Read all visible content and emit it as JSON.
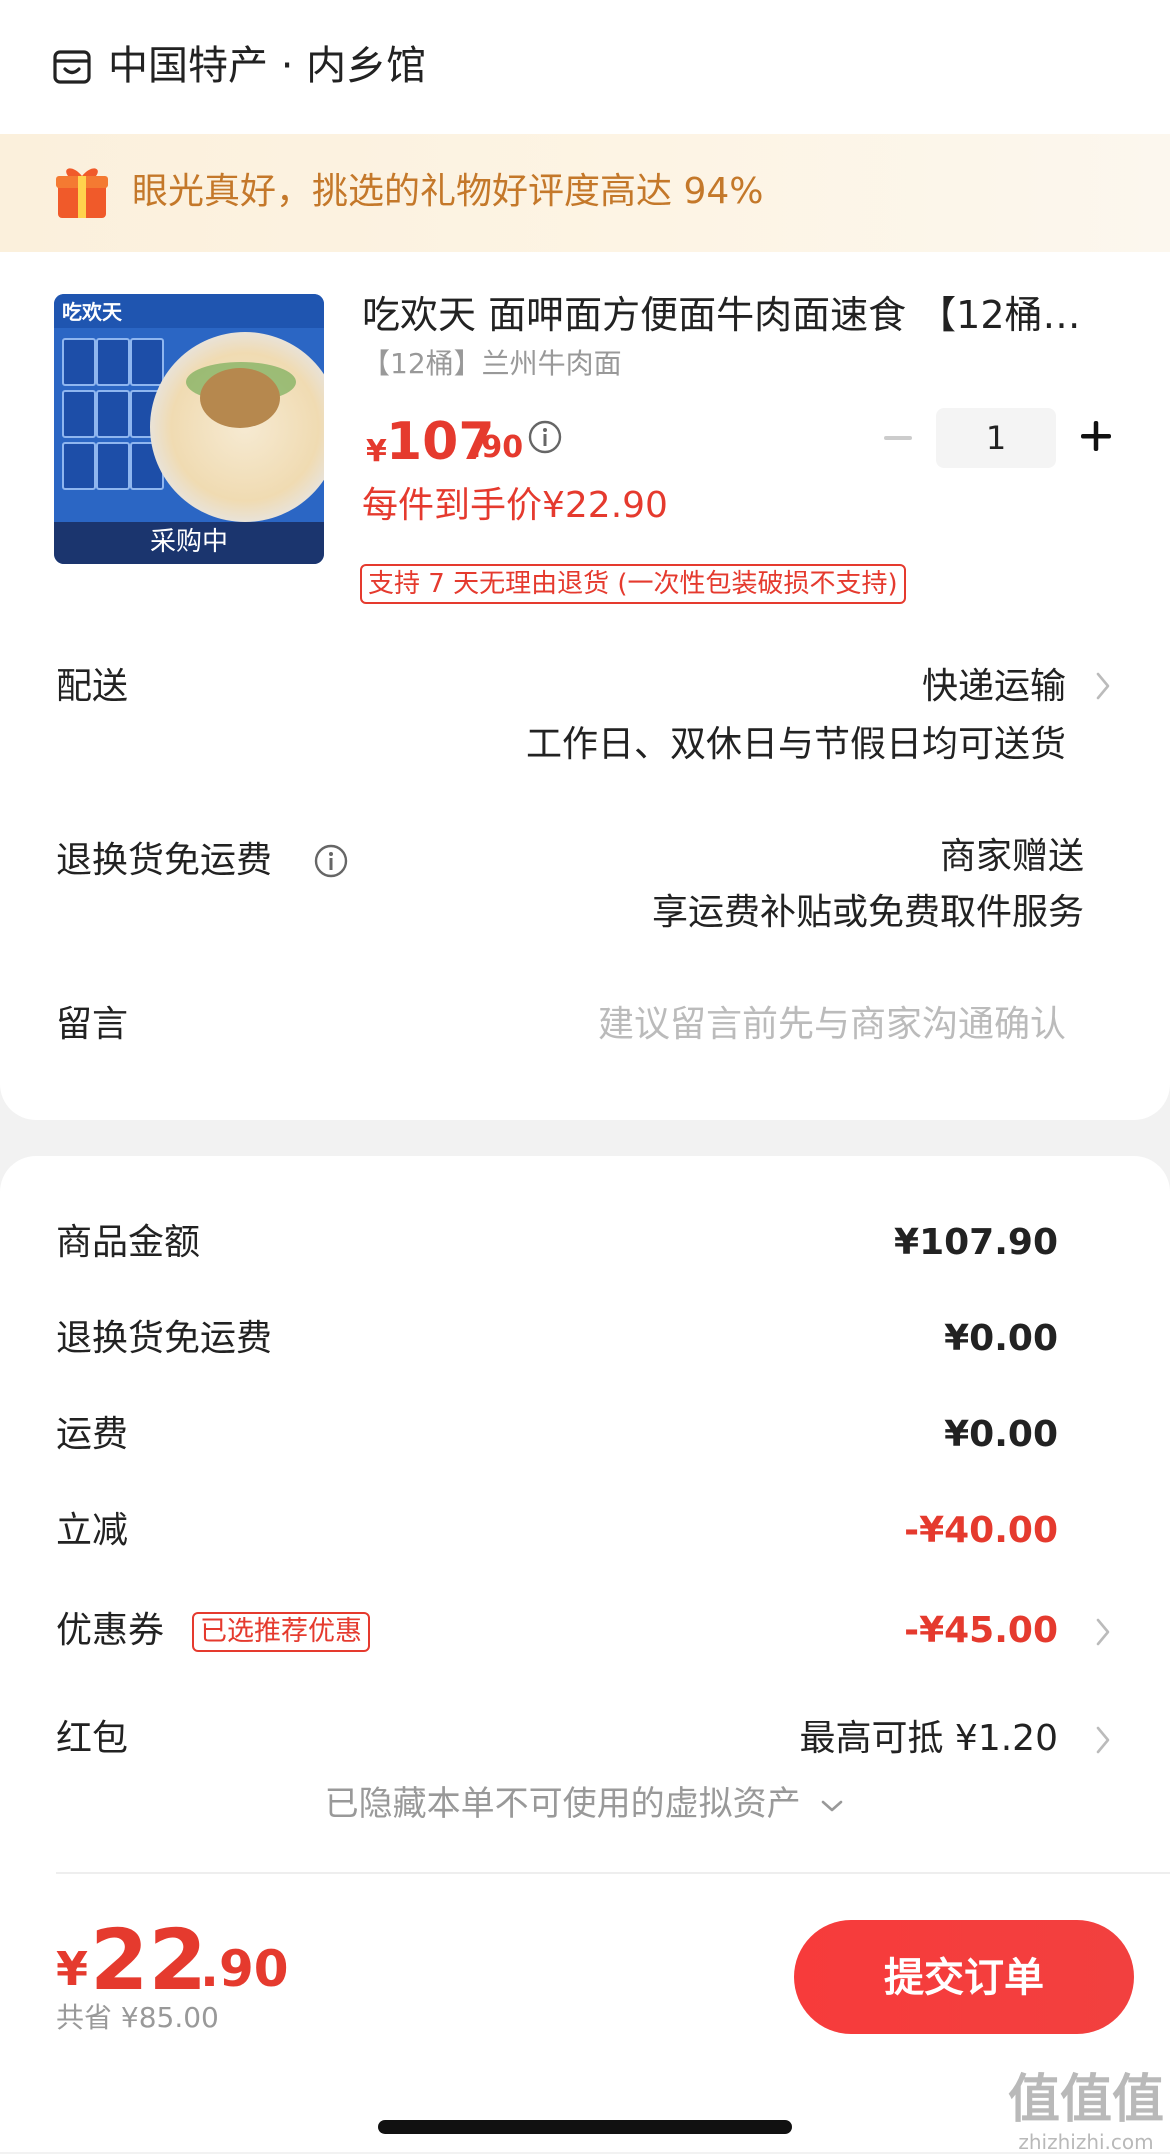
{
  "header": {
    "shop_name": "中国特产 · 内乡馆",
    "shop_icon": "store-icon"
  },
  "banner": {
    "text": "眼光真好，挑选的礼物好评度高达 94%",
    "icon": "gift-icon"
  },
  "product": {
    "image_brand": "吃欢天",
    "image_badge": "采购中",
    "title": "吃欢天 面呷面方便面牛肉面速食 【12桶…",
    "spec": "【12桶】兰州牛肉面",
    "price_currency": "¥",
    "price_integer": "107",
    "price_decimal": ".90",
    "quantity": "1",
    "unit_price": "每件到手价¥22.90",
    "return_policy": "支持 7 天无理由退货 (一次性包装破损不支持)"
  },
  "delivery": {
    "label": "配送",
    "method": "快递运输",
    "note": "工作日、双休日与节假日均可送货"
  },
  "return_shipping": {
    "label": "退换货免运费",
    "value": "商家赠送",
    "note": "享运费补贴或免费取件服务"
  },
  "message": {
    "label": "留言",
    "placeholder": "建议留言前先与商家沟通确认"
  },
  "summary": {
    "goods_amount_label": "商品金额",
    "goods_amount": "¥107.90",
    "return_fee_label": "退换货免运费",
    "return_fee": "¥0.00",
    "shipping_label": "运费",
    "shipping": "¥0.00",
    "discount_label": "立减",
    "discount": "-¥40.00",
    "coupon_label": "优惠券",
    "coupon_tag": "已选推荐优惠",
    "coupon": "-¥45.00",
    "redpacket_label": "红包",
    "redpacket": "最高可抵 ¥1.20",
    "hidden_assets": "已隐藏本单不可使用的虚拟资产"
  },
  "footer": {
    "total_currency": "¥",
    "total_integer": "22",
    "total_decimal": ".90",
    "saved": "共省 ¥85.00",
    "submit_label": "提交订单"
  },
  "watermark": {
    "line1": "值值值",
    "line2": "zhizhizhi.com"
  },
  "colors": {
    "accent": "#e53a2e",
    "banner_text": "#c4782a",
    "muted": "#999999"
  }
}
